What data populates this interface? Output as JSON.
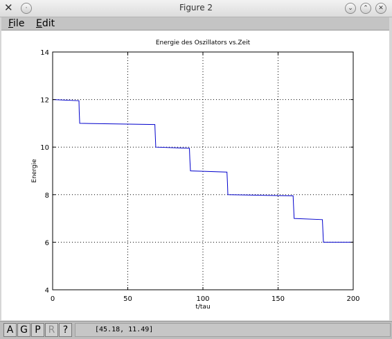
{
  "window": {
    "title": "Figure 2",
    "app_icon": "close-x-icon",
    "buttons": [
      {
        "name": "minimize-button",
        "icon": "chevron-down-icon",
        "glyph": "⌄"
      },
      {
        "name": "maximize-button",
        "icon": "chevron-up-icon",
        "glyph": "⌃"
      },
      {
        "name": "close-button",
        "icon": "close-icon",
        "glyph": "✕"
      }
    ]
  },
  "menu": {
    "items": [
      {
        "mnemonic": "F",
        "rest": "ile"
      },
      {
        "mnemonic": "E",
        "rest": "dit"
      }
    ]
  },
  "toolbar": {
    "buttons": [
      {
        "label": "A",
        "enabled": true
      },
      {
        "label": "G",
        "enabled": true
      },
      {
        "label": "P",
        "enabled": true
      },
      {
        "label": "R",
        "enabled": false
      },
      {
        "label": "?",
        "enabled": true
      }
    ],
    "status_text": "[45.18,  11.49]"
  },
  "chart_data": {
    "type": "line",
    "title": "Energie des Oszillators vs.Zeit",
    "xlabel": "t/tau",
    "ylabel": "Energie",
    "xlim": [
      0,
      200
    ],
    "ylim": [
      4,
      14
    ],
    "xticks": [
      0,
      50,
      100,
      150,
      200
    ],
    "yticks": [
      4,
      6,
      8,
      10,
      12,
      14
    ],
    "grid": true,
    "line_color": "#0000cc",
    "series": [
      {
        "x": [
          0,
          0,
          0.3,
          17.5,
          17.7,
          18,
          68,
          68.3,
          68.6,
          91,
          91.3,
          91.7,
          116,
          116.3,
          116.6,
          160,
          160.3,
          160.7,
          179.5,
          179.8,
          180.2,
          200
        ],
        "y": [
          12.3,
          12.0,
          12.0,
          11.95,
          11.5,
          11.0,
          10.95,
          10.5,
          10.0,
          9.95,
          9.5,
          9.0,
          8.95,
          8.5,
          8.0,
          7.95,
          7.5,
          7.0,
          6.95,
          6.5,
          6.0,
          6.0
        ]
      }
    ]
  }
}
